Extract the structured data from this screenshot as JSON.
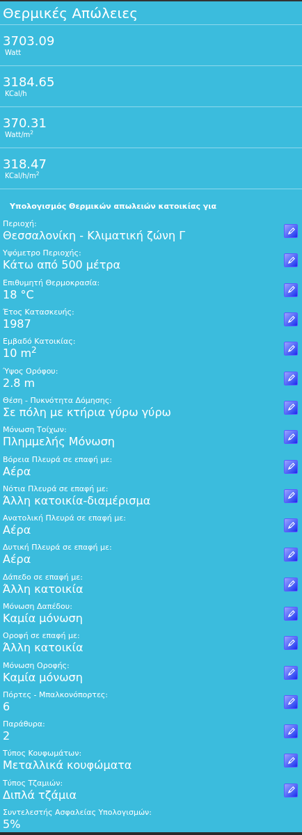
{
  "title": "Θερμικές Απώλειες",
  "results": [
    {
      "value": "3703.09",
      "unit": "Watt"
    },
    {
      "value": "3184.65",
      "unit": "KCal/h"
    },
    {
      "value": "370.31",
      "unit": "Watt/m$^{2}$"
    },
    {
      "value": "318.47",
      "unit": "KCal/h/m$^{2}$"
    }
  ],
  "section_heading": "Υπολογισμός Θερμικών απωλειών κατοικίας για",
  "fields": [
    {
      "label": "Περιοχή:",
      "value": "Θεσσαλονίκη - Κλιματική ζώνη Γ",
      "editable": true
    },
    {
      "label": "Υψόμετρο Περιοχής:",
      "value": "Κάτω από 500 μέτρα",
      "editable": true
    },
    {
      "label": "Επιθυμητή Θερμοκρασία:",
      "value": "18 °C",
      "editable": true
    },
    {
      "label": "Έτος Κατασκευής:",
      "value": "1987",
      "editable": true
    },
    {
      "label": "Εμβαδό Κατοικίας:",
      "value": "10 m$^{2}$",
      "editable": true
    },
    {
      "label": "Ύψος Ορόφου:",
      "value": "2.8 m",
      "editable": true
    },
    {
      "label": "Θέση - Πυκνότητα Δόμησης:",
      "value": "Σε πόλη με κτήρια γύρω γύρω",
      "editable": true
    },
    {
      "label": "Μόνωση Τοίχων:",
      "value": "Πλημμελής Μόνωση",
      "editable": true
    },
    {
      "label": "Βόρεια Πλευρά σε επαφή με:",
      "value": "Αέρα",
      "editable": true
    },
    {
      "label": "Νότια Πλευρά σε επαφή με:",
      "value": "Άλλη κατοικία-διαμέρισμα",
      "editable": true
    },
    {
      "label": "Ανατολική Πλευρά σε επαφή με:",
      "value": "Αέρα",
      "editable": true
    },
    {
      "label": "Δυτική Πλευρά σε επαφή με:",
      "value": "Αέρα",
      "editable": true
    },
    {
      "label": "Δάπεδο σε επαφή με:",
      "value": "Άλλη κατοικία",
      "editable": true
    },
    {
      "label": "Μόνωση Δαπέδου:",
      "value": "Καμία μόνωση",
      "editable": true
    },
    {
      "label": "Οροφή σε επαφή με:",
      "value": "Άλλη κατοικία",
      "editable": true
    },
    {
      "label": "Μόνωση Οροφής:",
      "value": "Καμία μόνωση",
      "editable": true
    },
    {
      "label": "Πόρτες - Μπαλκονόπορτες:",
      "value": "6",
      "editable": true
    },
    {
      "label": "Παράθυρα:",
      "value": "2",
      "editable": true
    },
    {
      "label": "Τύπος Κουφωμάτων:",
      "value": "Μεταλλικά κουφώματα",
      "editable": true
    },
    {
      "label": "Τύπος Τζαμιών:",
      "value": "Διπλά τζάμια",
      "editable": true
    },
    {
      "label": "Συντελεστής Ασφαλείας Υπολογισμών:",
      "value": "5%",
      "editable": false
    }
  ]
}
